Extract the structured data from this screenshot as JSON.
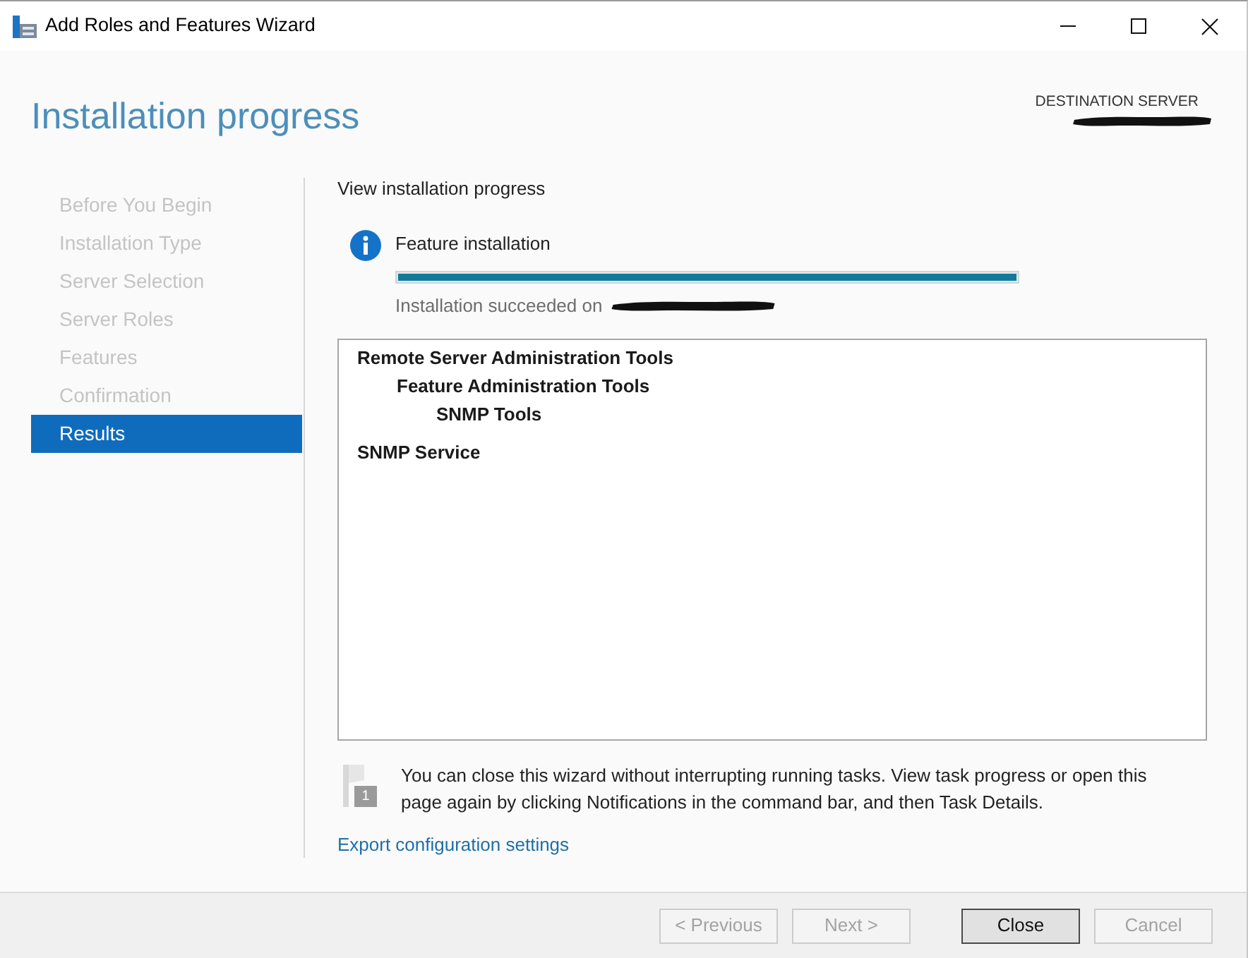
{
  "window": {
    "title": "Add Roles and Features Wizard"
  },
  "header": {
    "title": "Installation progress",
    "destination_label": "DESTINATION SERVER"
  },
  "steps": [
    {
      "label": "Before You Begin",
      "selected": false
    },
    {
      "label": "Installation Type",
      "selected": false
    },
    {
      "label": "Server Selection",
      "selected": false
    },
    {
      "label": "Server Roles",
      "selected": false
    },
    {
      "label": "Features",
      "selected": false
    },
    {
      "label": "Confirmation",
      "selected": false
    },
    {
      "label": "Results",
      "selected": true
    }
  ],
  "content": {
    "heading": "View installation progress",
    "status": {
      "title": "Feature installation",
      "level": 1,
      "message": "Installation succeeded on"
    }
  },
  "features": [
    {
      "label": "Remote Server Administration Tools",
      "children": [
        {
          "label": "Feature Administration Tools",
          "children": [
            {
              "label": "SNMP Tools"
            }
          ]
        }
      ]
    },
    {
      "label": "SNMP Service"
    }
  ],
  "note": {
    "badge": "1",
    "text": "You can close this wizard without interrupting running tasks. View task progress or open this page again by clicking Notifications in the command bar, and then Task Details."
  },
  "link": "Export configuration settings",
  "buttons": [
    {
      "label": "< Previous",
      "disabled": true,
      "default": false
    },
    {
      "label": "Next >",
      "disabled": true,
      "default": false
    },
    {
      "label": "Close",
      "disabled": false,
      "default": true
    },
    {
      "label": "Cancel",
      "disabled": true,
      "default": false
    }
  ]
}
